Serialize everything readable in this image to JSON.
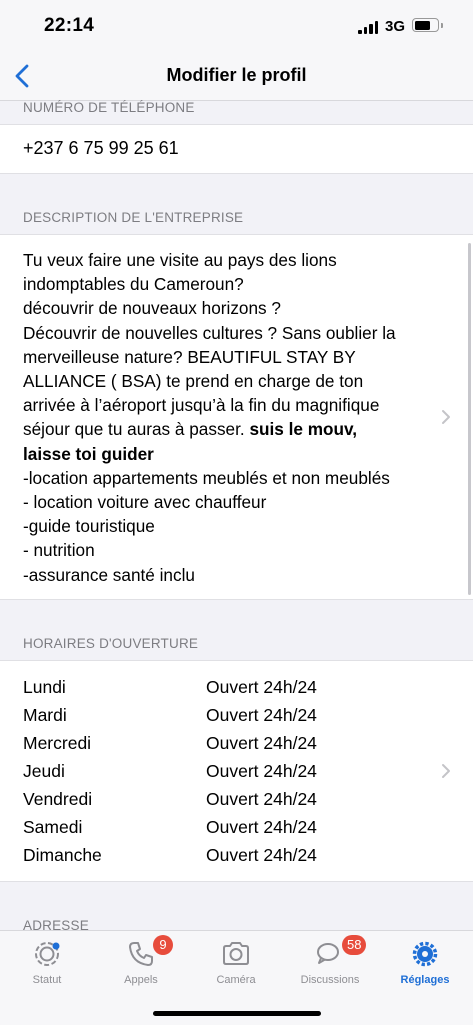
{
  "status_bar": {
    "time": "22:14",
    "network": "3G"
  },
  "nav": {
    "title": "Modifier le profil"
  },
  "phone_section": {
    "header": "NUMÉRO DE TÉLÉPHONE",
    "value": "+237 6 75 99 25 61"
  },
  "description_section": {
    "header": "DESCRIPTION DE L'ENTREPRISE",
    "lines": [
      "Tu veux faire une visite au pays des lions",
      "indomptables du Cameroun?",
      "découvrir de nouveaux horizons ?",
      "Découvrir de nouvelles cultures ? Sans oublier la",
      "merveilleuse nature? BEAUTIFUL STAY BY",
      "ALLIANCE ( BSA) te prend en charge de ton",
      "arrivée à l’aéroport jusqu’à la fin du magnifique",
      "séjour que tu auras à passer.",
      "suis le mouv,",
      "laisse toi guider",
      "-location appartements meublés et non meublés",
      "- location voiture avec chauffeur",
      "-guide touristique",
      "- nutrition",
      "-assurance santé inclu"
    ]
  },
  "hours_section": {
    "header": "HORAIRES D'OUVERTURE",
    "rows": [
      {
        "day": "Lundi",
        "hours": "Ouvert 24h/24"
      },
      {
        "day": "Mardi",
        "hours": "Ouvert 24h/24"
      },
      {
        "day": "Mercredi",
        "hours": "Ouvert 24h/24"
      },
      {
        "day": "Jeudi",
        "hours": "Ouvert 24h/24"
      },
      {
        "day": "Vendredi",
        "hours": "Ouvert 24h/24"
      },
      {
        "day": "Samedi",
        "hours": "Ouvert 24h/24"
      },
      {
        "day": "Dimanche",
        "hours": "Ouvert 24h/24"
      }
    ]
  },
  "address_section": {
    "header": "ADRESSE"
  },
  "tab_bar": {
    "tabs": [
      {
        "label": "Statut",
        "icon": "status-icon"
      },
      {
        "label": "Appels",
        "icon": "phone-icon",
        "badge": "9"
      },
      {
        "label": "Caméra",
        "icon": "camera-icon"
      },
      {
        "label": "Discussions",
        "icon": "chat-bubbles-icon",
        "badge": "58"
      },
      {
        "label": "Réglages",
        "icon": "settings-gear-icon"
      }
    ]
  },
  "colors": {
    "accent": "#1f6fd6",
    "badge": "#e74c3c",
    "background": "#f2f2f7"
  }
}
